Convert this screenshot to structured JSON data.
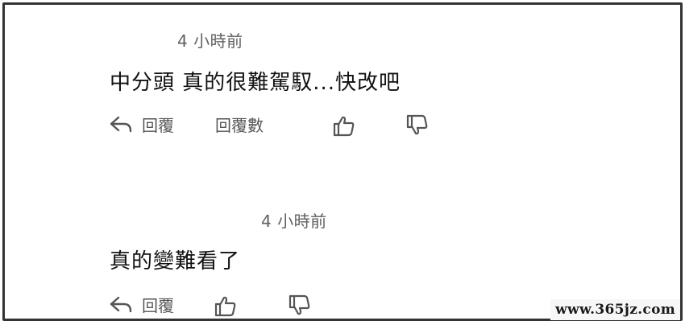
{
  "comments": [
    {
      "timestamp": "4 小時前",
      "text": "中分頭 真的很難駕馭...快改吧",
      "reply_label": "回覆",
      "replies_label": "回覆數"
    },
    {
      "timestamp": "4 小時前",
      "text": "真的變難看了",
      "reply_label": "回覆"
    }
  ],
  "icons": {
    "reply": "reply-arrow-icon",
    "like": "thumbs-up-icon",
    "dislike": "thumbs-down-icon"
  },
  "colors": {
    "text": "#111111",
    "muted": "#606060",
    "icon": "#555555",
    "border": "#333333"
  },
  "watermark": "www.365jz.com"
}
